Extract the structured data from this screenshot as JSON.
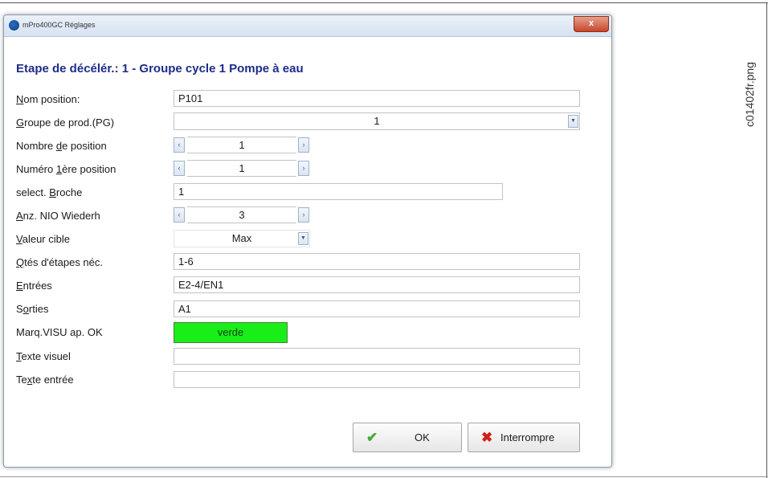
{
  "window": {
    "title": "mPro400GC Réglages",
    "close_symbol": "x"
  },
  "side_label": "c01402fr.png",
  "heading": "Etape de décélér.:  1 - Groupe cycle  1  Pompe à eau",
  "fields": {
    "nom_position": {
      "label_pre": "",
      "label_key": "N",
      "label_post": "om position:",
      "value": "P101"
    },
    "groupe_prod": {
      "label_pre": "",
      "label_key": "G",
      "label_post": "roupe de prod.(PG)",
      "value": "1"
    },
    "nombre_position": {
      "label_pre": "Nombre ",
      "label_key": "d",
      "label_post": "e position",
      "value": "1"
    },
    "numero_premiere": {
      "label_pre": "Numéro ",
      "label_key": "1",
      "label_post": "ère position",
      "value": "1"
    },
    "select_broche": {
      "label_pre": "select. ",
      "label_key": "B",
      "label_post": "roche",
      "value": "1"
    },
    "anz_nio": {
      "label_pre": "",
      "label_key": "A",
      "label_post": "nz. NIO Wiederh",
      "value": "3"
    },
    "valeur_cible": {
      "label_pre": "",
      "label_key": "V",
      "label_post": "aleur cible",
      "value": "Max"
    },
    "qtes_etapes": {
      "label_pre": "",
      "label_key": "Q",
      "label_post": "tés d'étapes néc.",
      "value": "1-6"
    },
    "entrees": {
      "label_pre": "",
      "label_key": "E",
      "label_post": "ntrées",
      "value": "E2-4/EN1"
    },
    "sorties": {
      "label_pre": "S",
      "label_key": "o",
      "label_post": "rties",
      "value": "A1"
    },
    "marq_visu": {
      "label_pre": "Marq.VISU ap. OK",
      "label_key": "",
      "label_post": "",
      "value": "verde",
      "color": "#19ee19"
    },
    "texte_visuel": {
      "label_pre": "",
      "label_key": "T",
      "label_post": "exte visuel",
      "value": ""
    },
    "texte_entree": {
      "label_pre": "Te",
      "label_key": "x",
      "label_post": "te entrée",
      "value": ""
    }
  },
  "spin": {
    "left": "‹",
    "right": "›"
  },
  "combo_arrow": "▼",
  "buttons": {
    "ok": {
      "label": "OK",
      "icon": "✔"
    },
    "cancel": {
      "label": "Interrompre",
      "icon": "✖"
    }
  },
  "colors": {
    "heading": "#1e2c8a",
    "ok_check": "#4aa832",
    "cancel_x": "#d0201a",
    "green_field": "#19ee19"
  }
}
